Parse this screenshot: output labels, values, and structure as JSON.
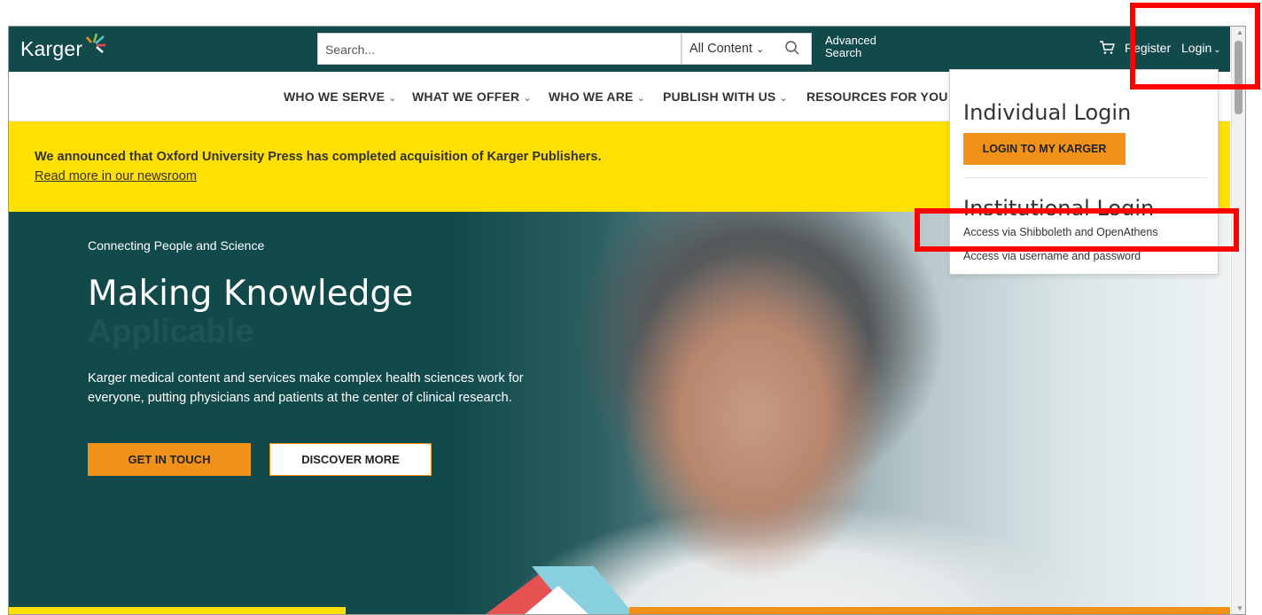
{
  "header": {
    "logo_text": "Karger",
    "search_placeholder": "Search...",
    "scope_value": "All Content",
    "advanced_search_line1": "Advanced",
    "advanced_search_line2": "Search",
    "register_label": "Register",
    "login_label": "Login"
  },
  "nav": {
    "items": [
      {
        "label": "WHO WE SERVE"
      },
      {
        "label": "WHAT WE OFFER"
      },
      {
        "label": "WHO WE ARE"
      },
      {
        "label": "PUBLISH WITH US"
      },
      {
        "label": "RESOURCES FOR YOU"
      }
    ]
  },
  "banner": {
    "text": "We announced that Oxford University Press has completed acquisition of Karger Publishers.",
    "link": "Read more in our newsroom"
  },
  "hero": {
    "subtitle": "Connecting People and Science",
    "title": "Making Knowledge",
    "title_word": "Applicable",
    "body": "Karger medical content and services make complex health sciences work for everyone, putting physicians and patients at the center of clinical research.",
    "primary_button": "GET IN TOUCH",
    "secondary_button": "DISCOVER MORE"
  },
  "login_dropdown": {
    "individual_heading": "Individual Login",
    "login_button": "LOGIN TO MY KARGER",
    "institutional_heading": "Institutional Login",
    "shibboleth_link": "Access via Shibboleth and OpenAthens",
    "username_link": "Access via username and password"
  },
  "colors": {
    "brand_teal": "#124a4c",
    "accent_orange": "#f0921a",
    "banner_yellow": "#ffe000",
    "highlight_red": "#ff0000"
  },
  "icons": {
    "search": "search-icon",
    "cart": "cart-icon",
    "chevron": "chevron-down-icon"
  }
}
